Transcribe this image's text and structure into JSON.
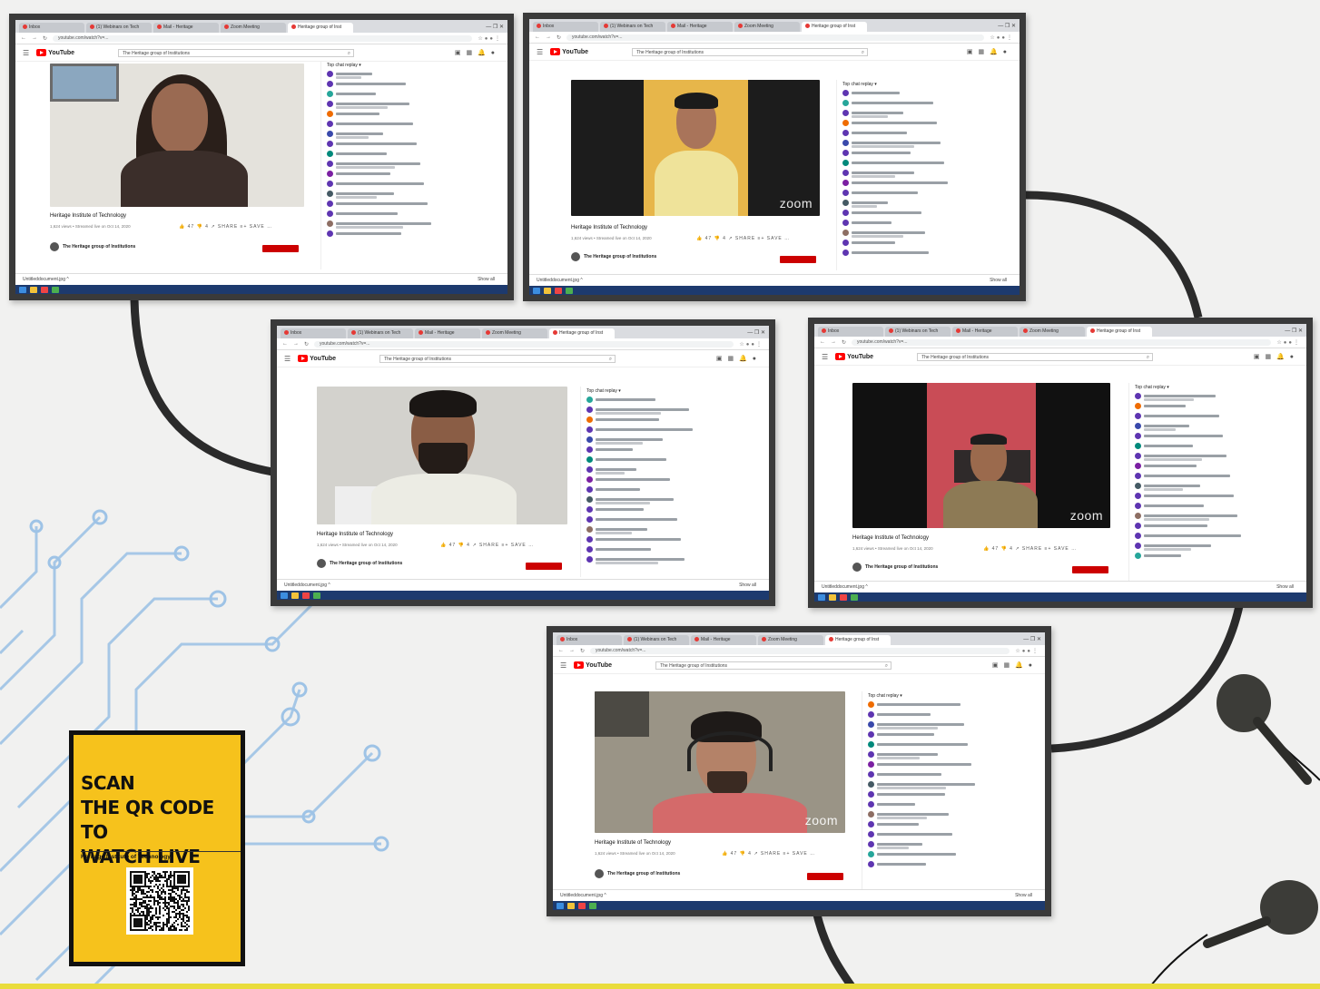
{
  "browser": {
    "tabs": [
      "Inbox",
      "(1) Webinars on Tech",
      "Mail - Heritage",
      "Zoom Meeting",
      "Heritage group of Inst"
    ],
    "url": "youtube.com/watch?v=...",
    "search_text": "The Heritage group of Institutions",
    "window_controls": "— ❐ ✕"
  },
  "youtube": {
    "logo_text": "YouTube",
    "channel_name": "The Heritage group of Institutions",
    "video_title": "Heritage Institute of Technology",
    "video_meta": "1,624 views • Streamed live on Oct 14, 2020",
    "actions": "👍 47  👎 4  ↗ SHARE  ≡+ SAVE  …",
    "chat_header": "Top chat replay ▾"
  },
  "download_bar": {
    "file": "Untitleddocument.jpg ^",
    "show_all": "Show all"
  },
  "zoom_label": "zoom",
  "qr": {
    "line1": "SCAN",
    "line2": "THE QR CODE TO",
    "line3": "WATCH LIVE",
    "subtitle": "Heritage Institute of Technology"
  },
  "colors": {
    "background": "#f1f1f0",
    "frame": "#3a3a3a",
    "qr_panel": "#f6c21c",
    "youtube_red": "#ff0000",
    "chat_avatar": "#5e35b1",
    "connector": "#2b2b2b",
    "circuit": "#9ec3e6"
  },
  "icons": [
    "menu-icon",
    "youtube-logo-icon",
    "search-icon",
    "video-camera-icon",
    "apps-icon",
    "bell-icon",
    "avatar-icon",
    "like-icon",
    "dislike-icon",
    "share-icon",
    "save-icon",
    "qr-code-icon",
    "earphone-icon"
  ]
}
